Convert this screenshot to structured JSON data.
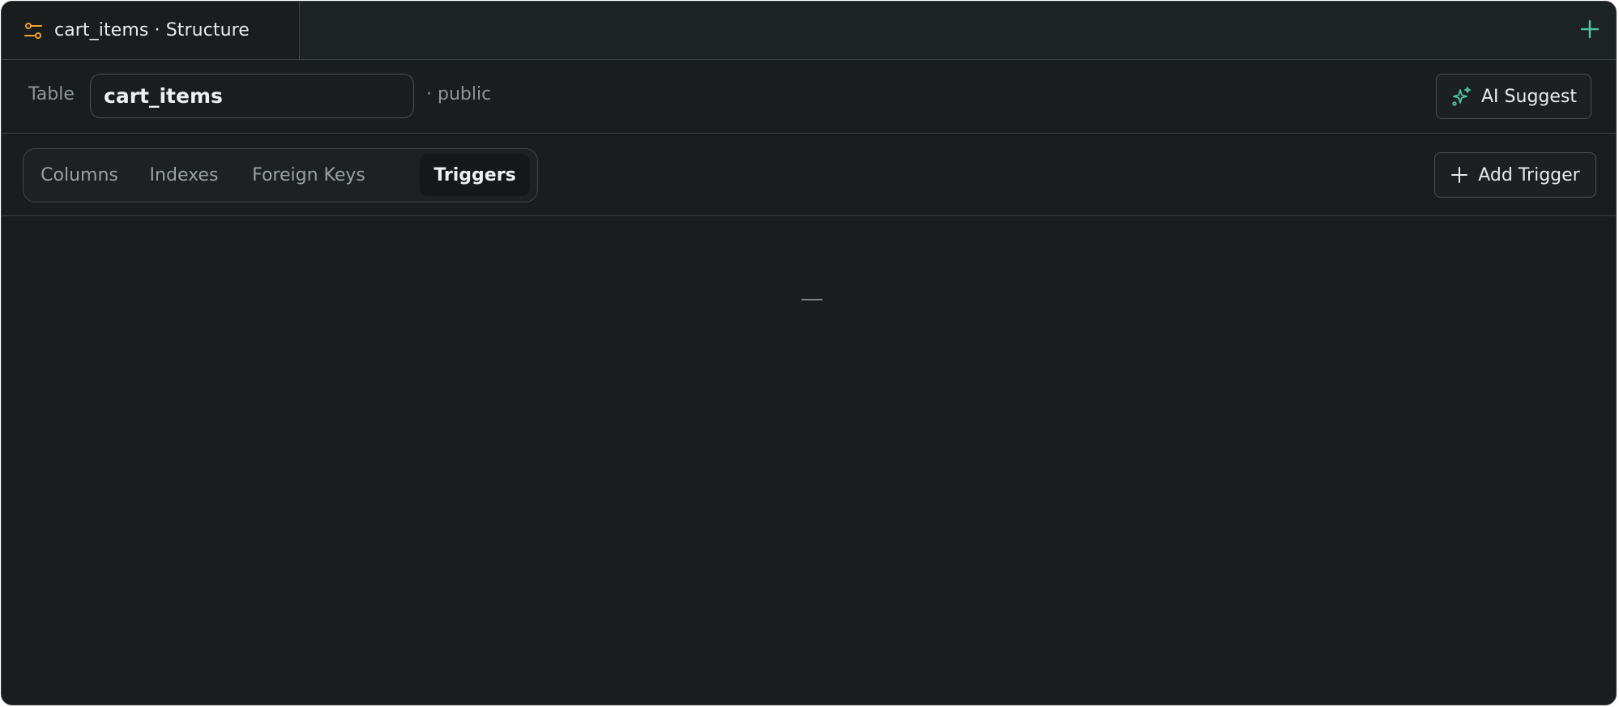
{
  "tab": {
    "title": "cart_items · Structure",
    "icon": "settings-sliders-icon"
  },
  "new_tab": {
    "icon": "plus-icon"
  },
  "table_bar": {
    "label": "Table",
    "table_name": "cart_items",
    "schema": "· public"
  },
  "ai_suggest": {
    "label": "AI Suggest",
    "icon": "sparkles-icon"
  },
  "tabs": [
    {
      "label": "Columns",
      "active": false
    },
    {
      "label": "Indexes",
      "active": false
    },
    {
      "label": "Foreign Keys",
      "active": false
    },
    {
      "label": "Triggers",
      "active": true
    }
  ],
  "add_trigger": {
    "label": "Add Trigger",
    "icon": "plus-icon"
  },
  "content": {
    "empty_text": "—"
  },
  "colors": {
    "background": "#1a1d1e",
    "accent_orange": "#f5a623",
    "accent_teal": "#4fc3a1"
  }
}
